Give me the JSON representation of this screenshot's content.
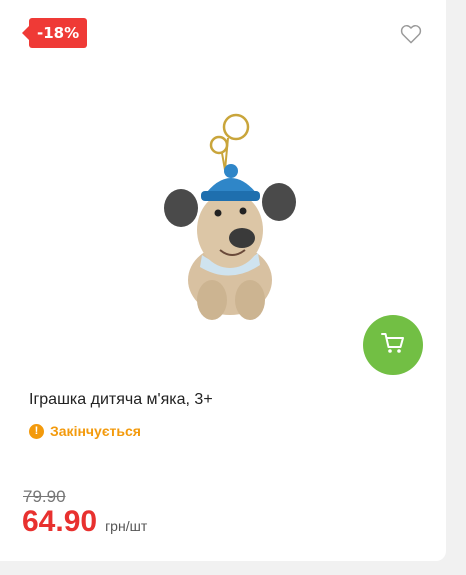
{
  "product": {
    "discount_badge": "-18%",
    "title": "Іграшка дитяча м'яка, 3+",
    "availability": "Закінчується",
    "old_price": "79.90",
    "price": "64.90",
    "unit": "грн/шт"
  },
  "icons": {
    "favorite": "heart-outline-icon",
    "cart": "shopping-cart-icon",
    "status": "warning-exclamation-icon"
  },
  "colors": {
    "discount": "#ef3a36",
    "cart_button": "#72bf44",
    "status": "#f39a0c",
    "price": "#e8312f"
  }
}
